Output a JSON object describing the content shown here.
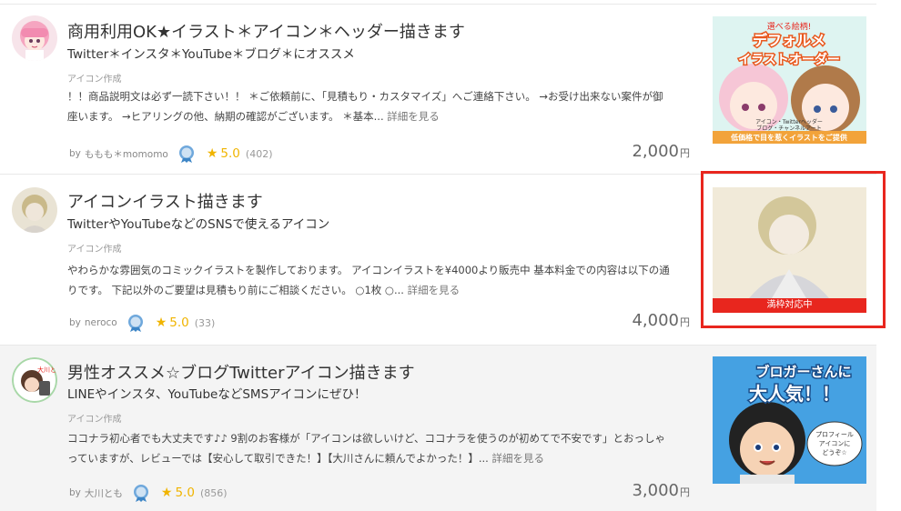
{
  "listings": [
    {
      "title": "商用利用OK★イラスト＊アイコン＊ヘッダー描きます",
      "subtitle": "Twitter＊インスタ＊YouTube＊ブログ＊にオススメ",
      "category": "アイコン作成",
      "desc_line1": "！！商品説明文は必ず一読下さい！！ ＊ご依頼前に、「見積もり・カスタマイズ」へご連絡下さい。 →お受け出来ない案件が御",
      "desc_line2": "座います。 →ヒアリングの他、納期の確認がございます。 ＊基本...",
      "more": "詳細を見る",
      "by": "by",
      "seller": "ももも＊momomo",
      "rating": "5.0",
      "reviews": "(402)",
      "price": "2,000",
      "currency": "円",
      "thumb_text_top": "選べる絵柄!",
      "thumb_text_main1": "デフォルメ",
      "thumb_text_main2": "イラストオーダー",
      "thumb_text_sub": "アイコン・Twitterヘッダー",
      "thumb_text_sub2": "ブログ・チャンネルアート",
      "thumb_text_bottom": "低価格で目を惹くイラストをご提供"
    },
    {
      "title": "アイコンイラスト描きます",
      "subtitle": "TwitterやYouTubeなどのSNSで使えるアイコン",
      "category": "アイコン作成",
      "desc_line1": "やわらかな雰囲気のコミックイラストを製作しております。 アイコンイラストを¥4000より販売中 基本料金での内容は以下の通",
      "desc_line2": "りです。 下記以外のご要望は見積もり前にご相談ください。 ○1枚 ○...",
      "more": "詳細を見る",
      "by": "by",
      "seller": "neroco",
      "rating": "5.0",
      "reviews": "(33)",
      "price": "4,000",
      "currency": "円",
      "badge": "満枠対応中"
    },
    {
      "title": "男性オススメ☆ブログTwitterアイコン描きます",
      "subtitle": "LINEやインスタ、YouTubeなどSMSアイコンにぜひ！",
      "category": "アイコン作成",
      "desc_line1": "ココナラ初心者でも大丈夫です♪♪ 9割のお客様が「アイコンは欲しいけど、ココナラを使うのが初めてで不安です」とおっしゃ",
      "desc_line2": "っていますが、レビューでは【安心して取引できた！】【大川さんに頼んでよかった！】...",
      "more": "詳細を見る",
      "by": "by",
      "seller": "大川とも",
      "rating": "5.0",
      "reviews": "(856)",
      "price": "3,000",
      "currency": "円",
      "avatar_text": "大川とも",
      "thumb_text_1": "ブロガーさんに",
      "thumb_text_2": "大人気！！",
      "thumb_bubble_1": "プロフィール",
      "thumb_bubble_2": "アイコンに",
      "thumb_bubble_3": "どうぞ☆"
    }
  ],
  "icons": {
    "star": "star-icon",
    "rank": "rank-medal-icon"
  },
  "colors": {
    "accent_red": "#e8261e",
    "star": "#f0b400"
  }
}
